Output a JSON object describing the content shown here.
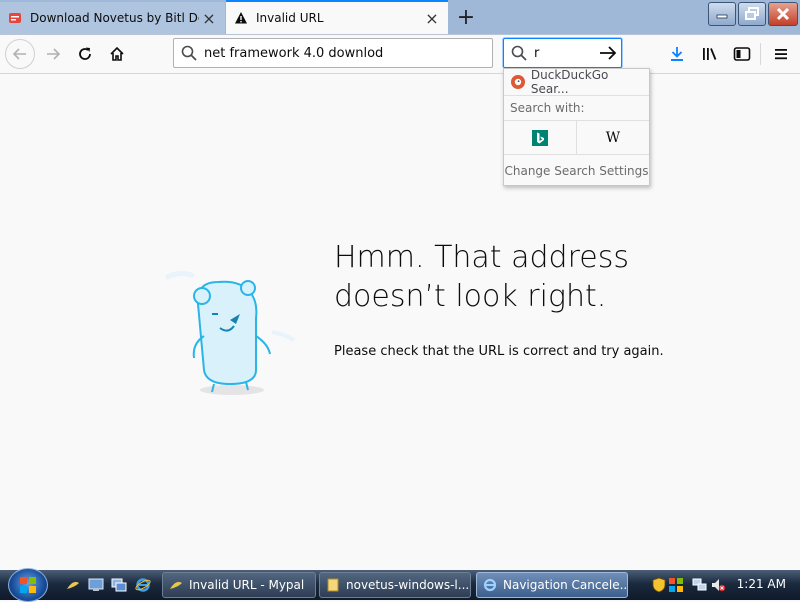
{
  "tabs": [
    {
      "title": "Download Novetus by Bitl Deve",
      "close": "×"
    },
    {
      "title": "Invalid URL",
      "close": "×"
    }
  ],
  "new_tab": "+",
  "url_bar": {
    "value": "net framework 4.0 downlod"
  },
  "search_bar": {
    "value": "r"
  },
  "search_dropdown": {
    "suggestion": "DuckDuckGo Sear...",
    "search_with_label": "Search with:",
    "engines": [
      "bing",
      "Wikipedia"
    ],
    "wiki_glyph": "W",
    "change_settings": "Change Search Settings"
  },
  "error_page": {
    "title_line1": "Hmm. That address",
    "title_line2": "doesn’t look right.",
    "description": "Please check that the URL is correct and try again."
  },
  "taskbar": {
    "tasks": [
      {
        "label": "Invalid URL - Mypal"
      },
      {
        "label": "novetus-windows-l..."
      },
      {
        "label": "Navigation Cancele..."
      }
    ],
    "clock": "1:21 AM"
  },
  "colors": {
    "accent": "#0a84ff",
    "bing": "#008373",
    "ddg": "#de5833"
  }
}
